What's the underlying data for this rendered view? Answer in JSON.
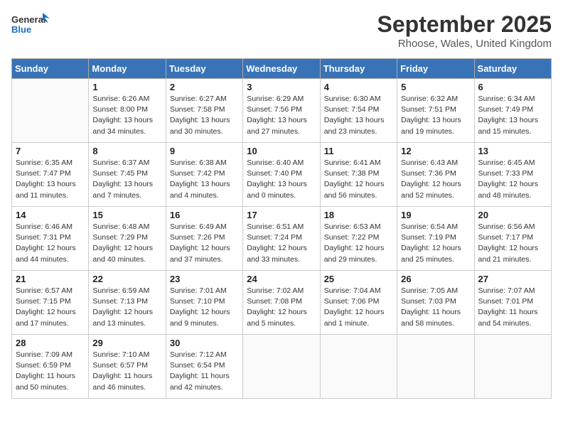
{
  "logo": {
    "line1": "General",
    "line2": "Blue"
  },
  "header": {
    "month": "September 2025",
    "location": "Rhoose, Wales, United Kingdom"
  },
  "weekdays": [
    "Sunday",
    "Monday",
    "Tuesday",
    "Wednesday",
    "Thursday",
    "Friday",
    "Saturday"
  ],
  "weeks": [
    [
      {
        "day": "",
        "content": ""
      },
      {
        "day": "1",
        "content": "Sunrise: 6:26 AM\nSunset: 8:00 PM\nDaylight: 13 hours\nand 34 minutes."
      },
      {
        "day": "2",
        "content": "Sunrise: 6:27 AM\nSunset: 7:58 PM\nDaylight: 13 hours\nand 30 minutes."
      },
      {
        "day": "3",
        "content": "Sunrise: 6:29 AM\nSunset: 7:56 PM\nDaylight: 13 hours\nand 27 minutes."
      },
      {
        "day": "4",
        "content": "Sunrise: 6:30 AM\nSunset: 7:54 PM\nDaylight: 13 hours\nand 23 minutes."
      },
      {
        "day": "5",
        "content": "Sunrise: 6:32 AM\nSunset: 7:51 PM\nDaylight: 13 hours\nand 19 minutes."
      },
      {
        "day": "6",
        "content": "Sunrise: 6:34 AM\nSunset: 7:49 PM\nDaylight: 13 hours\nand 15 minutes."
      }
    ],
    [
      {
        "day": "7",
        "content": "Sunrise: 6:35 AM\nSunset: 7:47 PM\nDaylight: 13 hours\nand 11 minutes."
      },
      {
        "day": "8",
        "content": "Sunrise: 6:37 AM\nSunset: 7:45 PM\nDaylight: 13 hours\nand 7 minutes."
      },
      {
        "day": "9",
        "content": "Sunrise: 6:38 AM\nSunset: 7:42 PM\nDaylight: 13 hours\nand 4 minutes."
      },
      {
        "day": "10",
        "content": "Sunrise: 6:40 AM\nSunset: 7:40 PM\nDaylight: 13 hours\nand 0 minutes."
      },
      {
        "day": "11",
        "content": "Sunrise: 6:41 AM\nSunset: 7:38 PM\nDaylight: 12 hours\nand 56 minutes."
      },
      {
        "day": "12",
        "content": "Sunrise: 6:43 AM\nSunset: 7:36 PM\nDaylight: 12 hours\nand 52 minutes."
      },
      {
        "day": "13",
        "content": "Sunrise: 6:45 AM\nSunset: 7:33 PM\nDaylight: 12 hours\nand 48 minutes."
      }
    ],
    [
      {
        "day": "14",
        "content": "Sunrise: 6:46 AM\nSunset: 7:31 PM\nDaylight: 12 hours\nand 44 minutes."
      },
      {
        "day": "15",
        "content": "Sunrise: 6:48 AM\nSunset: 7:29 PM\nDaylight: 12 hours\nand 40 minutes."
      },
      {
        "day": "16",
        "content": "Sunrise: 6:49 AM\nSunset: 7:26 PM\nDaylight: 12 hours\nand 37 minutes."
      },
      {
        "day": "17",
        "content": "Sunrise: 6:51 AM\nSunset: 7:24 PM\nDaylight: 12 hours\nand 33 minutes."
      },
      {
        "day": "18",
        "content": "Sunrise: 6:53 AM\nSunset: 7:22 PM\nDaylight: 12 hours\nand 29 minutes."
      },
      {
        "day": "19",
        "content": "Sunrise: 6:54 AM\nSunset: 7:19 PM\nDaylight: 12 hours\nand 25 minutes."
      },
      {
        "day": "20",
        "content": "Sunrise: 6:56 AM\nSunset: 7:17 PM\nDaylight: 12 hours\nand 21 minutes."
      }
    ],
    [
      {
        "day": "21",
        "content": "Sunrise: 6:57 AM\nSunset: 7:15 PM\nDaylight: 12 hours\nand 17 minutes."
      },
      {
        "day": "22",
        "content": "Sunrise: 6:59 AM\nSunset: 7:13 PM\nDaylight: 12 hours\nand 13 minutes."
      },
      {
        "day": "23",
        "content": "Sunrise: 7:01 AM\nSunset: 7:10 PM\nDaylight: 12 hours\nand 9 minutes."
      },
      {
        "day": "24",
        "content": "Sunrise: 7:02 AM\nSunset: 7:08 PM\nDaylight: 12 hours\nand 5 minutes."
      },
      {
        "day": "25",
        "content": "Sunrise: 7:04 AM\nSunset: 7:06 PM\nDaylight: 12 hours\nand 1 minute."
      },
      {
        "day": "26",
        "content": "Sunrise: 7:05 AM\nSunset: 7:03 PM\nDaylight: 11 hours\nand 58 minutes."
      },
      {
        "day": "27",
        "content": "Sunrise: 7:07 AM\nSunset: 7:01 PM\nDaylight: 11 hours\nand 54 minutes."
      }
    ],
    [
      {
        "day": "28",
        "content": "Sunrise: 7:09 AM\nSunset: 6:59 PM\nDaylight: 11 hours\nand 50 minutes."
      },
      {
        "day": "29",
        "content": "Sunrise: 7:10 AM\nSunset: 6:57 PM\nDaylight: 11 hours\nand 46 minutes."
      },
      {
        "day": "30",
        "content": "Sunrise: 7:12 AM\nSunset: 6:54 PM\nDaylight: 11 hours\nand 42 minutes."
      },
      {
        "day": "",
        "content": ""
      },
      {
        "day": "",
        "content": ""
      },
      {
        "day": "",
        "content": ""
      },
      {
        "day": "",
        "content": ""
      }
    ]
  ]
}
